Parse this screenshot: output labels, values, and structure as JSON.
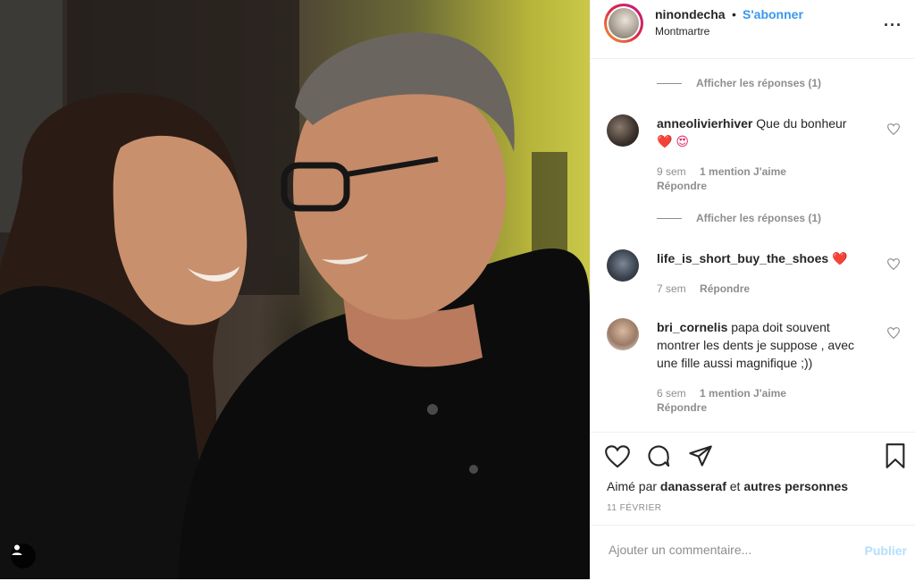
{
  "header": {
    "username": "ninondecha",
    "separator": "•",
    "follow_label": "S'abonner",
    "location": "Montmartre",
    "more_label": "···"
  },
  "comments": {
    "view_replies_1": "Afficher les réponses (1)",
    "view_replies_2": "Afficher les réponses (1)",
    "items": [
      {
        "username": "anneolivierhiver",
        "text": "Que du bonheur",
        "emoji": "❤️ 😍",
        "time": "9 sem",
        "likes": "1 mention J'aime",
        "reply": "Répondre"
      },
      {
        "username": "life_is_short_buy_the_shoes",
        "text": "",
        "emoji": "❤️",
        "time": "7 sem",
        "likes": "",
        "reply": "Répondre"
      },
      {
        "username": "bri_cornelis",
        "text": "papa doit souvent montrer les dents je suppose , avec une fille aussi magnifique ;))",
        "emoji": "",
        "time": "6 sem",
        "likes": "1 mention J'aime",
        "reply": "Répondre"
      }
    ]
  },
  "post": {
    "liked_by_prefix": "Aimé par",
    "liked_by_user": "danasseraf",
    "liked_by_and": "et",
    "liked_by_others": "autres personnes",
    "date": "11 FÉVRIER"
  },
  "add_comment": {
    "placeholder": "Ajouter un commentaire...",
    "post_label": "Publier"
  },
  "colors": {
    "accent": "#3897f0",
    "post_disabled": "#b2dffc",
    "muted": "#8e8e8e"
  },
  "icons": [
    "user-tag-icon",
    "heart-icon",
    "comment-icon",
    "share-icon",
    "bookmark-icon",
    "more-icon"
  ]
}
